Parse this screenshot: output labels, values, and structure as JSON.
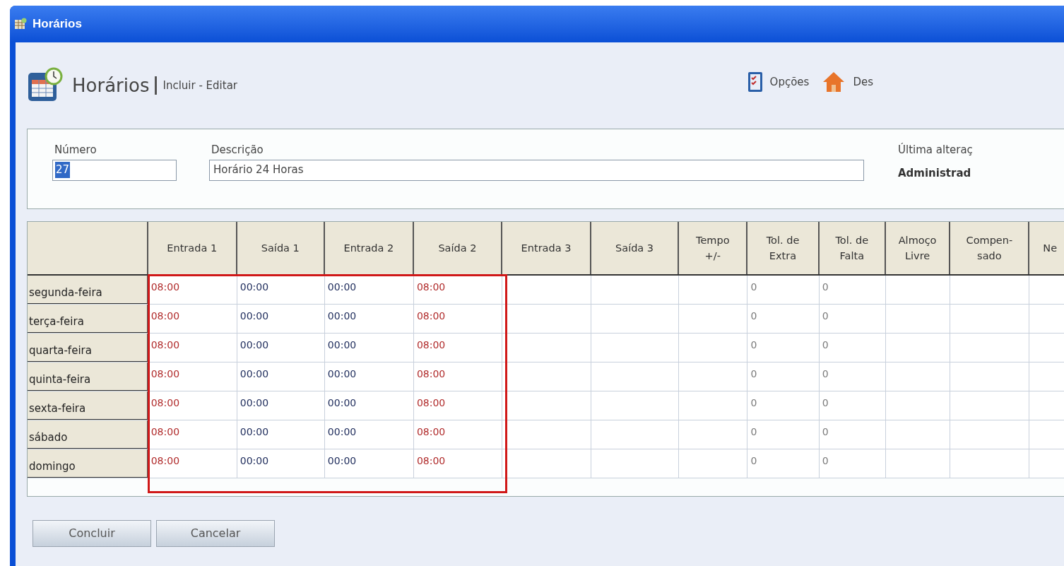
{
  "window": {
    "title": "Horários"
  },
  "header": {
    "title": "Horários",
    "subtitle": "Incluir - Editar"
  },
  "toolbar": [
    {
      "label": "Opções",
      "kind": "options"
    },
    {
      "label": "Des",
      "kind": "home"
    }
  ],
  "form": {
    "number": {
      "label": "Número",
      "value": "27",
      "selected": true
    },
    "description": {
      "label": "Descrição",
      "value": "Horário 24 Horas"
    },
    "last_change": {
      "label": "Última alteraç",
      "value": "Administrad"
    }
  },
  "table": {
    "columns": [
      {
        "label": "Entrada 1",
        "color": "#b02a2a",
        "highlighted": true
      },
      {
        "label": "Saída 1",
        "color": "#1c2a5a",
        "highlighted": true
      },
      {
        "label": "Entrada 2",
        "color": "#1c2a5a",
        "highlighted": true
      },
      {
        "label": "Saída 2",
        "color": "#b02a2a",
        "highlighted": true
      },
      {
        "label": "Entrada 3",
        "highlighted": false
      },
      {
        "label": "Saída 3",
        "highlighted": false
      },
      {
        "label": "Tempo\n+/-",
        "highlighted": false
      },
      {
        "label": "Tol. de\nExtra",
        "color": "#7a7a7a",
        "highlighted": false
      },
      {
        "label": "Tol. de\nFalta",
        "color": "#7a7a7a",
        "highlighted": false
      },
      {
        "label": "Almoço\nLivre",
        "highlighted": false
      },
      {
        "label": "Compen-\nsado",
        "highlighted": false
      },
      {
        "label": "Ne",
        "highlighted": false
      }
    ],
    "rows": [
      {
        "day": "segunda-feira",
        "cells": [
          "08:00",
          "00:00",
          "00:00",
          "08:00",
          null,
          null,
          null,
          "0",
          "0",
          null,
          null,
          null
        ]
      },
      {
        "day": "terça-feira",
        "cells": [
          "08:00",
          "00:00",
          "00:00",
          "08:00",
          null,
          null,
          null,
          "0",
          "0",
          null,
          null,
          null
        ]
      },
      {
        "day": "quarta-feira",
        "cells": [
          "08:00",
          "00:00",
          "00:00",
          "08:00",
          null,
          null,
          null,
          "0",
          "0",
          null,
          null,
          null
        ]
      },
      {
        "day": "quinta-feira",
        "cells": [
          "08:00",
          "00:00",
          "00:00",
          "08:00",
          null,
          null,
          null,
          "0",
          "0",
          null,
          null,
          null
        ]
      },
      {
        "day": "sexta-feira",
        "cells": [
          "08:00",
          "00:00",
          "00:00",
          "08:00",
          null,
          null,
          null,
          "0",
          "0",
          null,
          null,
          null
        ]
      },
      {
        "day": "sábado",
        "cells": [
          "08:00",
          "00:00",
          "00:00",
          "08:00",
          null,
          null,
          null,
          "0",
          "0",
          null,
          null,
          null
        ]
      },
      {
        "day": "domingo",
        "cells": [
          "08:00",
          "00:00",
          "00:00",
          "08:00",
          null,
          null,
          null,
          "0",
          "0",
          null,
          null,
          null
        ]
      }
    ]
  },
  "buttons": [
    "Concluir",
    "Cancelar"
  ]
}
